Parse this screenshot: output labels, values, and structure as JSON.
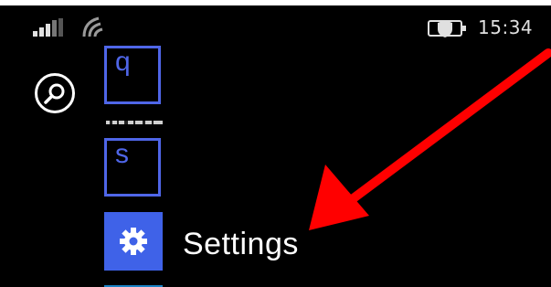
{
  "status_bar": {
    "time": "15:34",
    "icons": [
      "signal-icon",
      "wifi-icon",
      "battery-saver-icon"
    ]
  },
  "app_list": {
    "search_icon": "search-icon",
    "items": [
      {
        "type": "letter-tile",
        "label": "q"
      },
      {
        "type": "letter-tile",
        "label": "s"
      },
      {
        "type": "app",
        "icon": "gear-icon",
        "label": "Settings"
      }
    ]
  },
  "colors": {
    "accent": "#3f62e8",
    "annotation_arrow": "#ff0000",
    "background": "#000000"
  }
}
